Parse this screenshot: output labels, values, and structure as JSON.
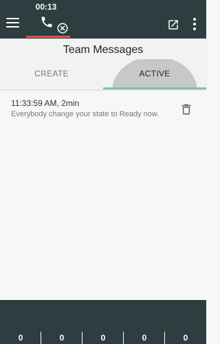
{
  "header": {
    "call_timer": "00:13",
    "icons": [
      "menu-icon",
      "phone-icon",
      "hangup-x-icon",
      "open-external-icon",
      "more-vert-icon"
    ],
    "colors": {
      "bar": "#2e3d3f",
      "call_underline": "#e05555"
    }
  },
  "panel": {
    "title": "Team Messages",
    "tabs": [
      {
        "label": "CREATE",
        "selected": false
      },
      {
        "label": "ACTIVE",
        "selected": true
      }
    ],
    "indicator_color": "#7ec4a4"
  },
  "messages": [
    {
      "time": "11:33:59 AM, 2min",
      "text": "Everybody change your state to Ready now.",
      "icon": "delete-icon"
    }
  ],
  "footer": {
    "counters": [
      "0",
      "0",
      "0",
      "0",
      "0"
    ]
  }
}
